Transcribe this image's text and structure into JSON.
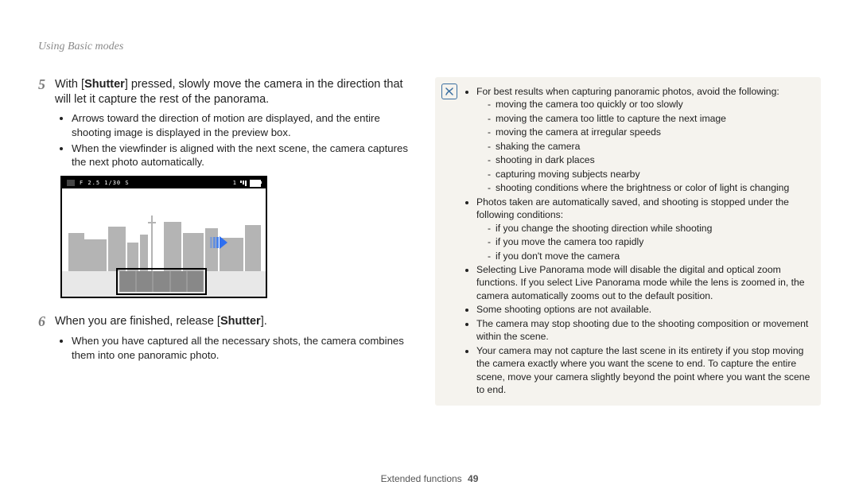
{
  "header": {
    "title": "Using Basic modes"
  },
  "steps": {
    "s5": {
      "num": "5",
      "pre": "With [",
      "bold": "Shutter",
      "post": "] pressed, slowly move the camera in the direction that will let it capture the rest of the panorama.",
      "bullets": [
        "Arrows toward the direction of motion are displayed, and the entire shooting image is displayed in the preview box.",
        "When the viewfinder is aligned with the next scene, the camera captures the next photo automatically."
      ]
    },
    "s6": {
      "num": "6",
      "pre": "When you are finished, release [",
      "bold": "Shutter",
      "post": "].",
      "bullets": [
        "When you have captured all the necessary shots, the camera combines them into one panoramic photo."
      ]
    }
  },
  "preview": {
    "exposure": "F 2.5 1/30 S",
    "count1": "1"
  },
  "tips": {
    "t1": "For best results when capturing panoramic photos, avoid the following:",
    "t1_sub": [
      "moving the camera too quickly or too slowly",
      "moving the camera too little to capture the next image",
      "moving the camera at irregular speeds",
      "shaking the camera",
      "shooting in dark places",
      "capturing moving subjects nearby",
      "shooting conditions where the brightness or color of light is changing"
    ],
    "t2": "Photos taken are automatically saved, and shooting is stopped under the following conditions:",
    "t2_sub": [
      "if you change the shooting direction while shooting",
      "if you move the camera too rapidly",
      "if you don't move the camera"
    ],
    "t3": "Selecting Live Panorama mode will disable the digital and optical zoom functions. If you select Live Panorama mode while the lens is zoomed in, the camera automatically zooms out to the default position.",
    "t4": "Some shooting options are not available.",
    "t5": "The camera may stop shooting due to the shooting composition or movement within the scene.",
    "t6": "Your camera may not capture the last scene in its entirety if you stop moving the camera exactly where you want the scene to end. To capture the entire scene, move your camera slightly beyond the point where you want the scene to end."
  },
  "footer": {
    "section": "Extended functions",
    "page": "49"
  }
}
